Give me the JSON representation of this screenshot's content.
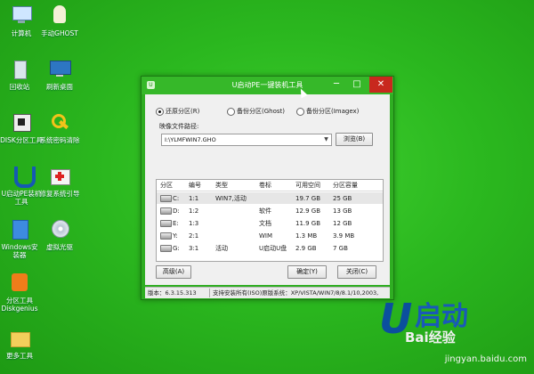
{
  "desktop": {
    "icons": [
      {
        "label": "计算机",
        "icon": "computer-icon"
      },
      {
        "label": "手动GHOST",
        "icon": "ghost-icon"
      },
      {
        "label": "回收站",
        "icon": "recycle-bin-icon"
      },
      {
        "label": "刷新桌面",
        "icon": "monitor-icon"
      },
      {
        "label": "DISK分区工具",
        "icon": "disk-tool-icon"
      },
      {
        "label": "系统密码清除",
        "icon": "key-icon"
      },
      {
        "label": "U启动PE装机",
        "label2": "工具",
        "icon": "installer-icon"
      },
      {
        "label": "修复系统引导",
        "icon": "repair-kit-icon"
      },
      {
        "label": "Windows安",
        "label2": "装器",
        "icon": "windows-installer-icon"
      },
      {
        "label": "虚拟光驱",
        "icon": "virtual-drive-icon"
      },
      {
        "label": "分区工具",
        "label2": "Diskgenius",
        "icon": "diskgenius-icon"
      },
      {
        "label": "更多工具",
        "icon": "folder-icon"
      }
    ]
  },
  "window": {
    "title": "U启动PE一键装机工具",
    "controls": {
      "minimize": "─",
      "maximize": "□",
      "close": "✕"
    },
    "radios": [
      {
        "label": "还原分区(R)",
        "checked": true
      },
      {
        "label": "备份分区(Ghost)",
        "checked": false
      },
      {
        "label": "备份分区(Imagex)",
        "checked": false
      }
    ],
    "path_label": "映像文件路径:",
    "path_value": "I:\\YLMFWIN7.GHO",
    "browse_label": "浏览(B)",
    "table": {
      "headers": [
        "分区",
        "编号",
        "类型",
        "卷标",
        "可用空间",
        "分区容量"
      ],
      "rows": [
        [
          "C:",
          "1:1",
          "WIN7,活动",
          "",
          "19.7 GB",
          "25 GB"
        ],
        [
          "D:",
          "1:2",
          "",
          "软件",
          "12.9 GB",
          "13 GB"
        ],
        [
          "E:",
          "1:3",
          "",
          "文档",
          "11.9 GB",
          "12 GB"
        ],
        [
          "Y:",
          "2:1",
          "",
          "WIM",
          "1.3 MB",
          "3.9 MB"
        ],
        [
          "G:",
          "3:1",
          "活动",
          "U启动U盘",
          "2.9 GB",
          "7 GB"
        ]
      ],
      "selected_row": 0
    },
    "buttons": {
      "advanced": "高级(A)",
      "ok": "确定(Y)",
      "close": "关闭(C)"
    },
    "status": {
      "version": "版本：6.3.15.313",
      "support": "支持安装所有(ISO)原版系统：XP/VISTA/WIN7/8/8.1/10,2003,"
    }
  },
  "branding": {
    "u": "U",
    "name": "启动",
    "watermark1": "Bai经验",
    "watermark2": "jingyan.baidu.com"
  },
  "colors": {
    "desktop": "#2bb81f",
    "titlebar": "#36b829",
    "close": "#c8281e",
    "brand": "#0b4f9e"
  }
}
